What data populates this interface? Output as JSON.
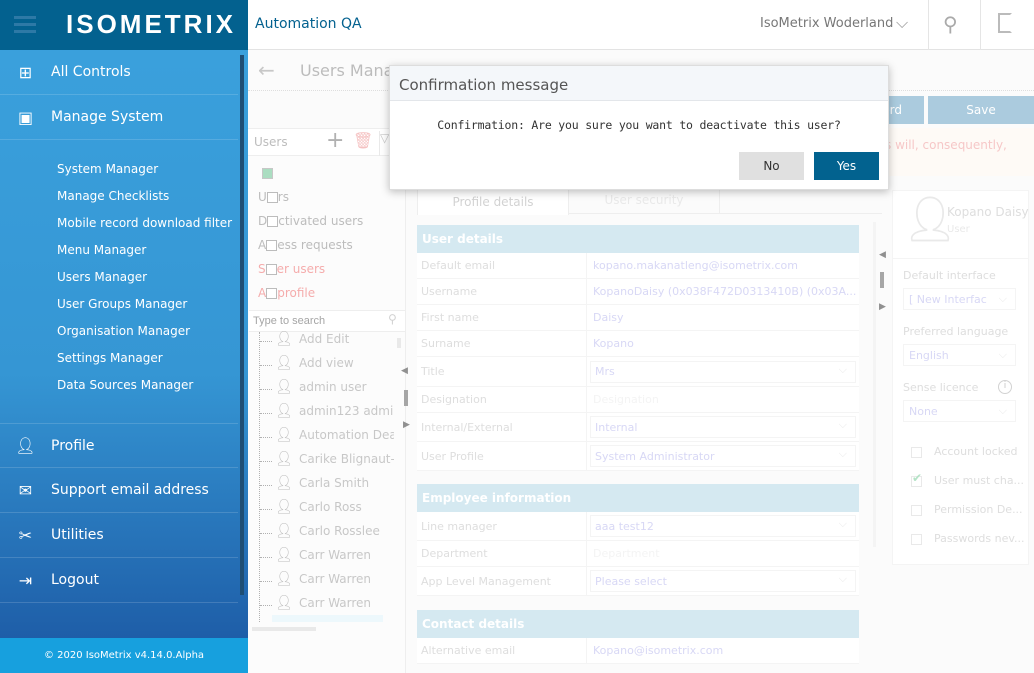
{
  "header": {
    "logo": "ISOMETRIX",
    "app": "Automation QA",
    "site": "IsoMetrix Woderland"
  },
  "sidebar": {
    "items": [
      {
        "label": "All Controls",
        "icon": "sitemap-icon"
      },
      {
        "label": "Manage System",
        "icon": "system-icon"
      }
    ],
    "sub": [
      "System Manager",
      "Manage Checklists",
      "Mobile record download filter",
      "Menu Manager",
      "Users Manager",
      "User Groups Manager",
      "Organisation Manager",
      "Settings Manager",
      "Data Sources Manager"
    ],
    "bottom": [
      {
        "label": "Profile",
        "icon": "user-icon"
      },
      {
        "label": "Support email address",
        "icon": "mail-icon"
      },
      {
        "label": "Utilities",
        "icon": "tools-icon"
      },
      {
        "label": "Logout",
        "icon": "logout-icon"
      }
    ],
    "footer": "© 2020 IsoMetrix v4.14.0.Alpha"
  },
  "page": {
    "title": "Users Manag",
    "btn_partial": "ord",
    "save": "Save",
    "warning": "s will, consequently,"
  },
  "left": {
    "header": "Users",
    "filters": [
      {
        "a": "U",
        "b": "rs"
      },
      {
        "a": "D",
        "b": "ctivated users"
      },
      {
        "a": "A",
        "b": "ess requests"
      },
      {
        "a": "S",
        "b": "er users"
      },
      {
        "a": "A",
        "b": "profile"
      }
    ],
    "search_placeholder": "Type to search",
    "users": [
      "Add Edit",
      "Add view",
      "admin user",
      "admin123 admin:",
      "Automation Deac",
      "Carike Blignaut-S",
      "Carla Smith",
      "Carlo Ross",
      "Carlo Rosslee",
      "Carr Warren",
      "Carr Warren",
      "Carr Warren"
    ]
  },
  "tabs": [
    "Profile details",
    "User security"
  ],
  "user_details": {
    "title": "User details",
    "rows": [
      {
        "label": "Default email",
        "value": "kopano.makanatleng@isometrix.com"
      },
      {
        "label": "Username",
        "value": "KopanoDaisy (0x038F472D0313410B) (0x03A..."
      },
      {
        "label": "First name",
        "value": "Daisy"
      },
      {
        "label": "Surname",
        "value": "Kopano"
      },
      {
        "label": "Title",
        "value": "Mrs",
        "select": true
      },
      {
        "label": "Designation",
        "value": "Designation"
      },
      {
        "label": "Internal/External",
        "value": "Internal",
        "select": true
      },
      {
        "label": "User Profile",
        "value": "System Administrator",
        "select": true
      }
    ]
  },
  "employee": {
    "title": "Employee information",
    "rows": [
      {
        "label": "Line manager",
        "value": "aaa test12",
        "select": true
      },
      {
        "label": "Department",
        "value": "Department"
      },
      {
        "label": "App Level Management",
        "value": "Please select",
        "select": true
      }
    ]
  },
  "contact": {
    "title": "Contact details",
    "rows": [
      {
        "label": "Alternative email",
        "value": "Kopano@isometrix.com"
      }
    ]
  },
  "profile_card": {
    "name": "Kopano Daisy",
    "role": "User"
  },
  "right": {
    "default_interface_label": "Default interface",
    "default_interface": "[ New Interfac",
    "lang_label": "Preferred language",
    "lang": "English",
    "licence_label": "Sense licence",
    "licence": "None",
    "checks": [
      {
        "label": "Account locked",
        "checked": false
      },
      {
        "label": "User must cha...",
        "checked": true
      },
      {
        "label": "Permission De...",
        "checked": false
      },
      {
        "label": "Passwords nev...",
        "checked": false
      }
    ]
  },
  "modal": {
    "title": "Confirmation message",
    "message": "Confirmation: Are you sure you want to deactivate this user?",
    "no": "No",
    "yes": "Yes",
    "yes_color": "#02628f"
  }
}
